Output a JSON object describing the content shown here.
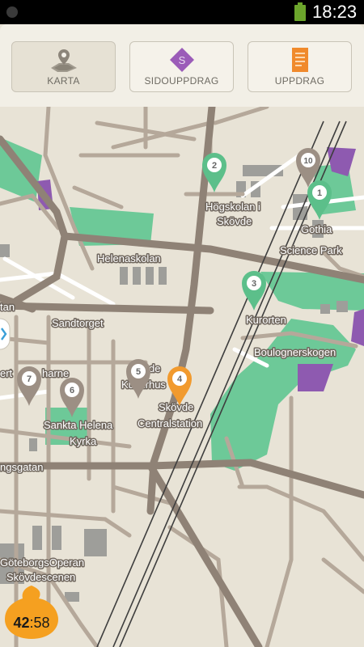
{
  "status_bar": {
    "time": "18:23"
  },
  "tabs": [
    {
      "label": "KARTA",
      "icon": "map-pin-icon"
    },
    {
      "label": "SIDOUPPDRAG",
      "icon": "tag-icon"
    },
    {
      "label": "UPPDRAG",
      "icon": "document-icon"
    }
  ],
  "map": {
    "labels": {
      "hogskolan_1": "Högskolan i",
      "hogskolan_2": "Skövde",
      "gothia_1": "Gothia",
      "gothia_2": "Science Park",
      "helenaskolan": "Helenaskolan",
      "tan": "tan",
      "sandtorget": "Sandtorget",
      "kurorten": "Kurorten",
      "boulognerskogen": "Boulognerskogen",
      "kulturhus_1": "de",
      "kulturhus_2": "Kulturhus",
      "centralstation_1": "Skövde",
      "centralstation_2": "Centralstation",
      "ert": "ert",
      "harne": "harne",
      "sankta_1": "Sankta Helena",
      "sankta_2": "Kyrka",
      "ingsgatan": "ngsgatan",
      "operan_1": "GöteborgsOperan",
      "operan_2": "Skövdescenen"
    },
    "pins": [
      {
        "number": "1",
        "color": "#5cbf8a"
      },
      {
        "number": "2",
        "color": "#5cbf8a"
      },
      {
        "number": "3",
        "color": "#5cbf8a"
      },
      {
        "number": "4",
        "color": "#f19a2e"
      },
      {
        "number": "5",
        "color": "#9c8f84"
      },
      {
        "number": "6",
        "color": "#9c8f84"
      },
      {
        "number": "7",
        "color": "#9c8f84"
      },
      {
        "number": "10",
        "color": "#9c8f84"
      }
    ]
  },
  "timer": {
    "minutes": "42",
    "seconds": ":58"
  }
}
